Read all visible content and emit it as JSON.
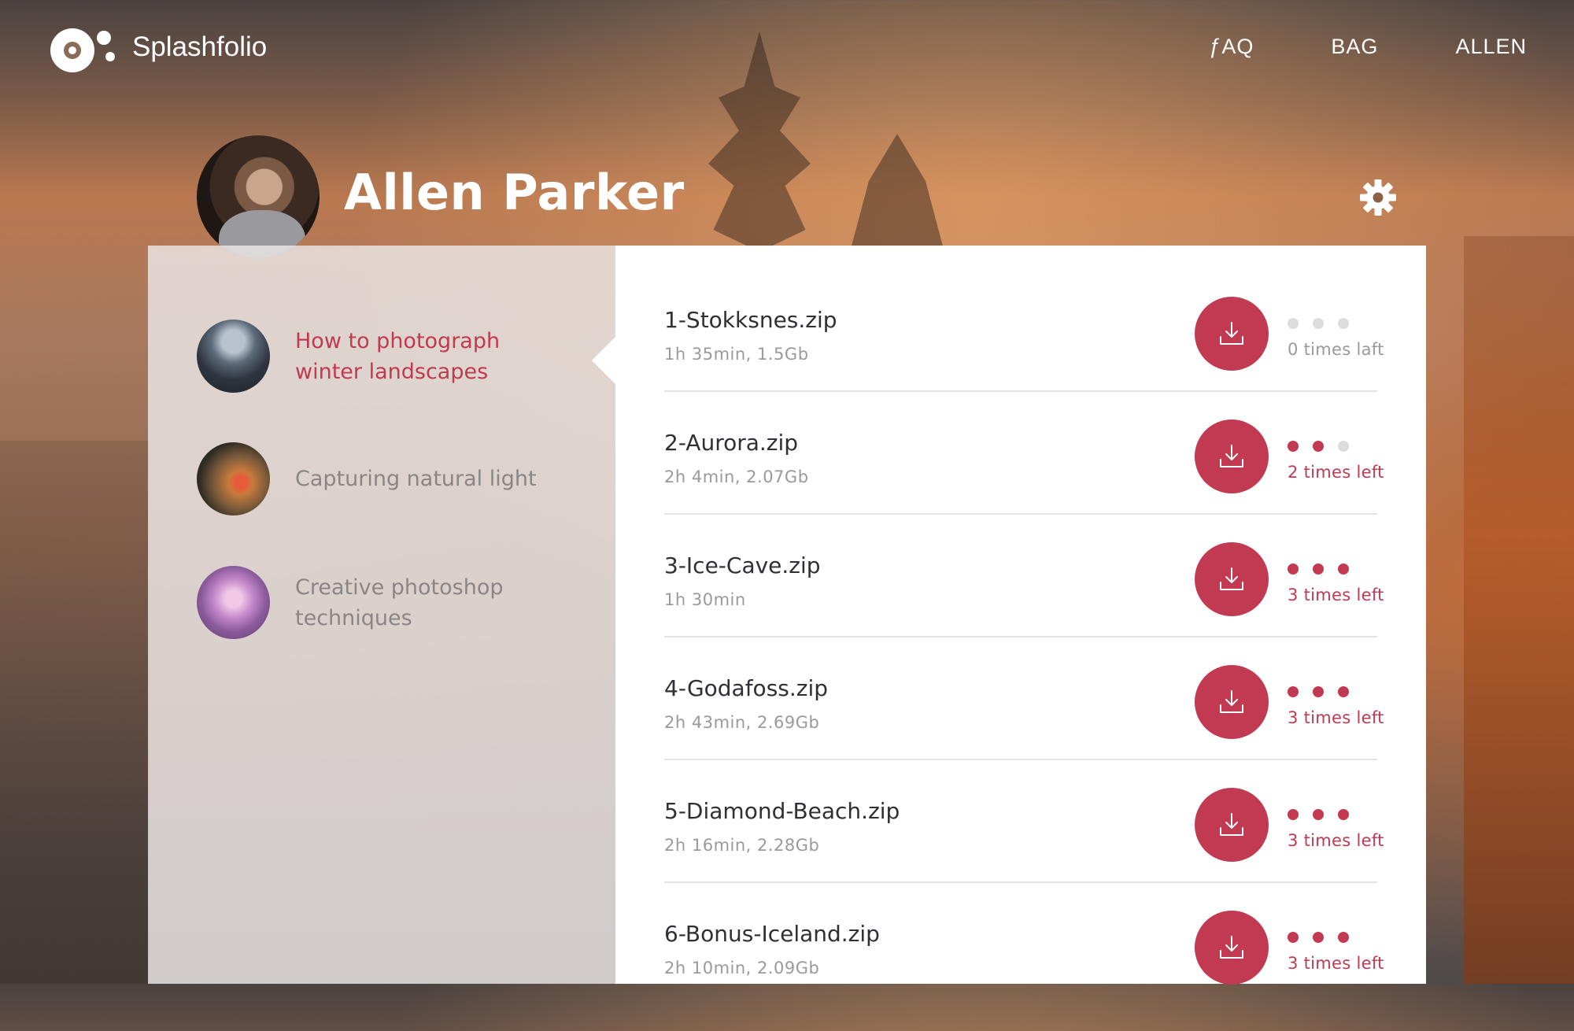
{
  "header": {
    "brand": "Splashfolio",
    "nav": [
      "ƒAQ",
      "BAG",
      "ALLEN"
    ]
  },
  "user": {
    "name": "Allen Parker"
  },
  "courses": [
    {
      "title": "How to photograph winter landscapes",
      "active": true
    },
    {
      "title": "Capturing natural light",
      "active": false
    },
    {
      "title": "Creative photoshop techniques",
      "active": false
    }
  ],
  "files": [
    {
      "name": "1-Stokksnes.zip",
      "meta": "1h 35min, 1.5Gb",
      "times": "0 times laft",
      "remaining": 0
    },
    {
      "name": "2-Aurora.zip",
      "meta": "2h 4min, 2.07Gb",
      "times": "2 times left",
      "remaining": 2
    },
    {
      "name": "3-Ice-Cave.zip",
      "meta": "1h 30min",
      "times": "3 times left",
      "remaining": 3
    },
    {
      "name": "4-Godafoss.zip",
      "meta": "2h 43min, 2.69Gb",
      "times": "3 times left",
      "remaining": 3
    },
    {
      "name": "5-Diamond-Beach.zip",
      "meta": "2h 16min, 2.28Gb",
      "times": "3 times left",
      "remaining": 3
    },
    {
      "name": "6-Bonus-Iceland.zip",
      "meta": "2h 10min, 2.09Gb",
      "times": "3 times left",
      "remaining": 3
    }
  ],
  "colors": {
    "accent": "#c23a52",
    "muted": "#9a9a9a"
  }
}
